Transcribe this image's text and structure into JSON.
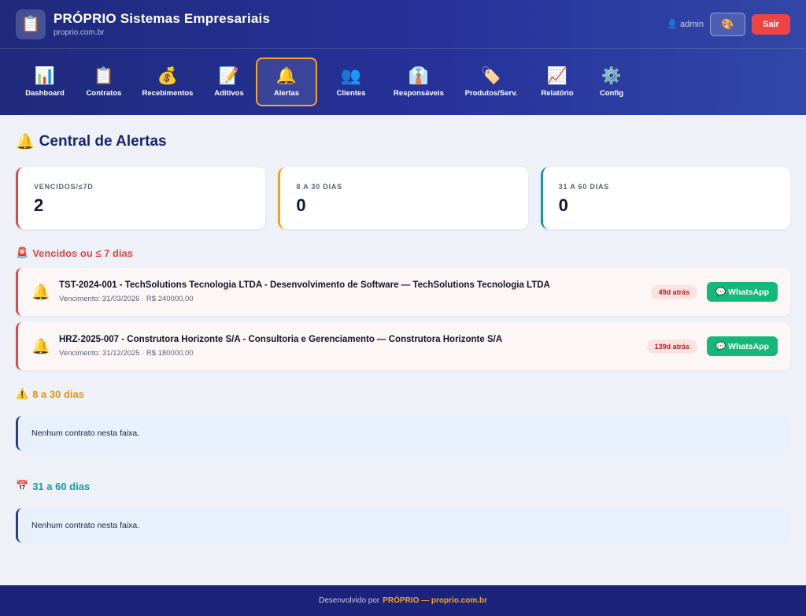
{
  "header": {
    "logo_icon": "clipboard-icon",
    "title": "PRÓPRIO Sistemas Empresariais",
    "subtitle": "proprio.com.br",
    "user_label": "admin",
    "user_icon": "👤",
    "theme_icon": "🎨",
    "logout_label": "Sair"
  },
  "nav": [
    {
      "label": "Dashboard",
      "icon": "📊",
      "name": "tab-dashboard",
      "active": false
    },
    {
      "label": "Contratos",
      "icon": "📋",
      "name": "tab-contratos",
      "active": false
    },
    {
      "label": "Recebimentos",
      "icon": "💰",
      "name": "tab-recebimentos",
      "active": false
    },
    {
      "label": "Aditivos",
      "icon": "📝",
      "name": "tab-aditivos",
      "active": false
    },
    {
      "label": "Alertas",
      "icon": "🔔",
      "name": "tab-alertas",
      "active": true
    },
    {
      "label": "Clientes",
      "icon": "👥",
      "name": "tab-clientes",
      "active": false
    },
    {
      "label": "Responsáveis",
      "icon": "👔",
      "name": "tab-responsaveis",
      "active": false
    },
    {
      "label": "Produtos/Serv.",
      "icon": "🏷️",
      "name": "tab-produtos",
      "active": false
    },
    {
      "label": "Relatório",
      "icon": "📈",
      "name": "tab-relatorio",
      "active": false
    },
    {
      "label": "Config",
      "icon": "⚙️",
      "name": "tab-config",
      "active": false
    }
  ],
  "page": {
    "title": "Central de Alertas",
    "title_icon": "🔔"
  },
  "stats": [
    {
      "label": "VENCIDOS/≤7D",
      "value": "2",
      "color": "#e04848"
    },
    {
      "label": "8 A 30 DIAS",
      "value": "0",
      "color": "#f2a21a"
    },
    {
      "label": "31 A 60 DIAS",
      "value": "0",
      "color": "#1597a7"
    }
  ],
  "sections": {
    "overdue": {
      "icon": "🚨",
      "title": "Vencidos ou ≤ 7 dias",
      "items": [
        {
          "title": "TST-2024-001 - TechSolutions Tecnologia LTDA - Desenvolvimento de Software — TechSolutions Tecnologia LTDA",
          "subtitle": "Vencimento: 31/03/2026 · R$ 240000,00",
          "badge": "49d atrás",
          "action": "💬 WhatsApp"
        },
        {
          "title": "HRZ-2025-007 - Construtora Horizonte S/A - Consultoria e Gerenciamento — Construtora Horizonte S/A",
          "subtitle": "Vencimento: 31/12/2025 · R$ 180000,00",
          "badge": "139d atrás",
          "action": "💬 WhatsApp"
        }
      ]
    },
    "days_8_30": {
      "icon": "⚠️",
      "title": "8 a 30 dias",
      "empty": "Nenhum contrato nesta faixa."
    },
    "days_31_60": {
      "icon": "📅",
      "title": "31 a 60 dias",
      "empty": "Nenhum contrato nesta faixa."
    }
  },
  "footer": {
    "prefix": "Desenvolvido por",
    "brand": "PRÓPRIO — proprio.com.br"
  },
  "colors": {
    "header_start": "#1f2a7c",
    "accent": "#f5a524",
    "danger": "#e04848",
    "whatsapp": "#14b87a"
  }
}
